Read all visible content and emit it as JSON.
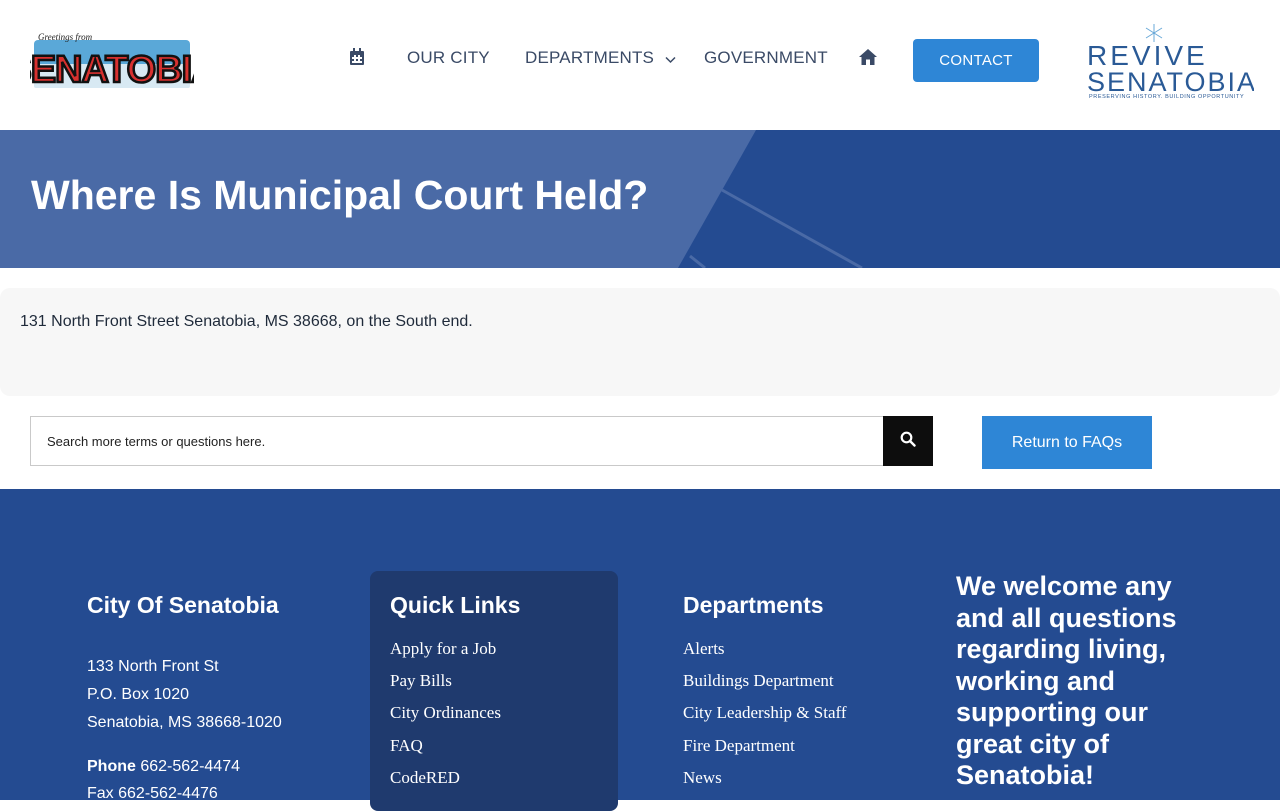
{
  "header": {
    "logo_text": "SENATOBIA",
    "logo_tagline": "Greetings from",
    "nav": {
      "our_city": "OUR CITY",
      "departments": "DEPARTMENTS",
      "government": "GOVERNMENT",
      "contact": "CONTACT"
    },
    "revive_logo": {
      "line1": "REVIVE",
      "line2": "SENATOBIA",
      "tagline": "PRESERVING HISTORY. BUILDING OPPORTUNITY"
    }
  },
  "hero": {
    "title": "Where Is Municipal Court Held?"
  },
  "answer": {
    "text": "131 North Front Street Senatobia, MS 38668, on the South end."
  },
  "search": {
    "placeholder": "Search more terms or questions here.",
    "return_label": "Return to FAQs"
  },
  "footer": {
    "city": {
      "heading": "City Of Senatobia",
      "address1": "133 North Front St",
      "address2": "P.O. Box 1020",
      "address3": "Senatobia, MS 38668-1020",
      "phone_label": "Phone",
      "phone": "662-562-4474",
      "fax_label": "Fax",
      "fax": "662-562-4476"
    },
    "quick_links": {
      "heading": "Quick Links",
      "items": [
        "Apply for a Job",
        "Pay Bills",
        "City Ordinances",
        "FAQ",
        "CodeRED"
      ]
    },
    "departments": {
      "heading": "Departments",
      "items": [
        "Alerts",
        "Buildings Department",
        "City Leadership & Staff",
        "Fire Department",
        "News"
      ]
    },
    "welcome": "We welcome any and all questions regarding living, working and supporting our great city of Senatobia!"
  },
  "colors": {
    "primary_blue": "#244b91",
    "button_blue": "#2e86d6",
    "hero_light": "#4a6aa6"
  }
}
